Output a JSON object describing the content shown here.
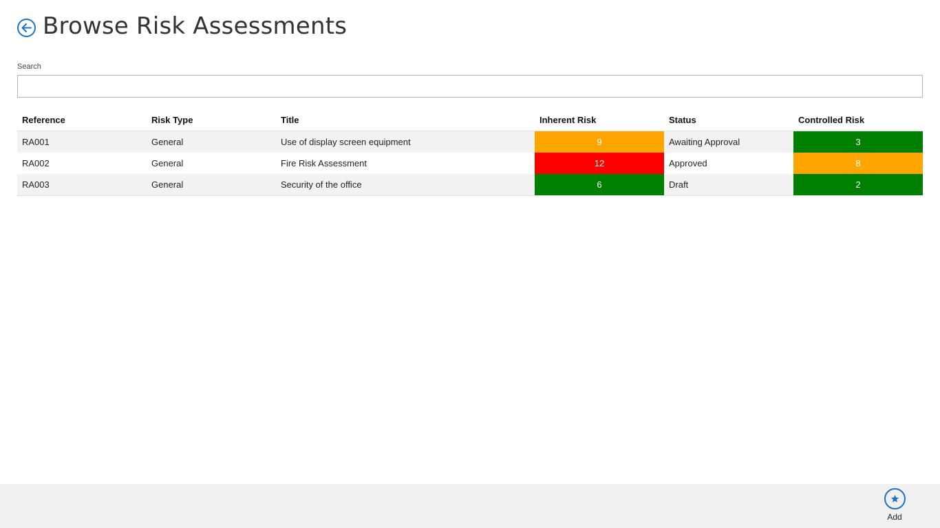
{
  "header": {
    "title": "Browse Risk Assessments",
    "back_icon": "arrow-left-icon"
  },
  "search": {
    "label": "Search",
    "value": "",
    "placeholder": ""
  },
  "table": {
    "columns": [
      "Reference",
      "Risk Type",
      "Title",
      "Inherent Risk",
      "Status",
      "Controlled Risk"
    ],
    "rows": [
      {
        "reference": "RA001",
        "risk_type": "General",
        "title": "Use of display screen equipment",
        "inherent_risk": "9",
        "inherent_color": "#ffa500",
        "status": "Awaiting Approval",
        "controlled_risk": "3",
        "controlled_color": "#008000"
      },
      {
        "reference": "RA002",
        "risk_type": "General",
        "title": "Fire Risk Assessment",
        "inherent_risk": "12",
        "inherent_color": "#ff0000",
        "status": "Approved",
        "controlled_risk": "8",
        "controlled_color": "#ffa500"
      },
      {
        "reference": "RA003",
        "risk_type": "General",
        "title": "Security of the office",
        "inherent_risk": "6",
        "inherent_color": "#008000",
        "status": "Draft",
        "controlled_risk": "2",
        "controlled_color": "#008000"
      }
    ]
  },
  "app_bar": {
    "add_label": "Add",
    "add_icon": "star-icon"
  },
  "colors": {
    "accent": "#1a73c7",
    "risk_low": "#008000",
    "risk_medium": "#ffa500",
    "risk_high": "#ff0000",
    "app_bar_bg": "#f0f0f0"
  }
}
